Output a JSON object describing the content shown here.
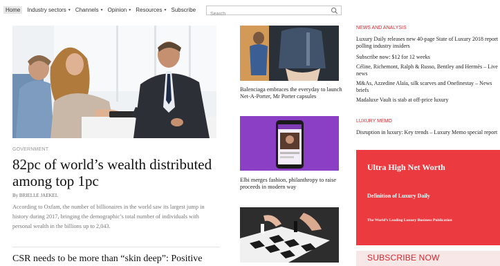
{
  "nav": {
    "items": [
      {
        "label": "Home",
        "caret": false
      },
      {
        "label": "Industry sectors",
        "caret": true
      },
      {
        "label": "Channels",
        "caret": true
      },
      {
        "label": "Opinion",
        "caret": true
      },
      {
        "label": "Resources",
        "caret": true
      },
      {
        "label": "Subscribe",
        "caret": false
      }
    ],
    "search_placeholder": "Search"
  },
  "feature": {
    "section": "GOVERNMENT",
    "headline": "82pc of world’s wealth distributed among top 1pc",
    "byline": "By BRIELLE JAEKEL",
    "summary": "According to Oxfam, the number of billionaires in the world saw its largest jump in history during 2017, bringing the demographic’s total number of individuals with personal wealth in the billions up to 2,043.",
    "next_headline": "CSR needs to be more than “skin deep”: Positive"
  },
  "middle": {
    "caption1": "Balenciaga embraces the everyday to launch Net-A-Porter, Mr Porter capsules",
    "caption2": "Elbi merges fashion, philanthropy to raise proceeds in modern way"
  },
  "right": {
    "news_heading": "NEWS AND ANALYSIS",
    "news_items": [
      "Luxury Daily releases new 40-page State of Luxury 2018 report polling industry insiders",
      "Subscribe now: $12 for 12 weeks",
      "Céline, Richemont, Ralph & Russo, Bentley and Hermès – Live news",
      "M&As, Azzedine Alaïa, silk scarves and Onefinestay – News briefs",
      "Madaluxe Vault is stab at off-price luxury"
    ],
    "memo_heading": "LUXURY MEMO",
    "memo_items": [
      "Disruption in luxury: Key trends – Luxury Memo special report"
    ]
  },
  "promo": {
    "title": "Ultra High Net Worth",
    "subtitle": "Definition of Luxury Daily",
    "tagline": "The World’s Leading Luxury Business Publication",
    "cta": "SUBSCRIBE NOW"
  },
  "colors": {
    "accent": "#d8262b",
    "promo_background": "#ec3b40",
    "tile2_purple": "#8a3fc4"
  },
  "icons": {
    "search": "magnifier-icon",
    "dropdown": "chevron-down-icon"
  }
}
